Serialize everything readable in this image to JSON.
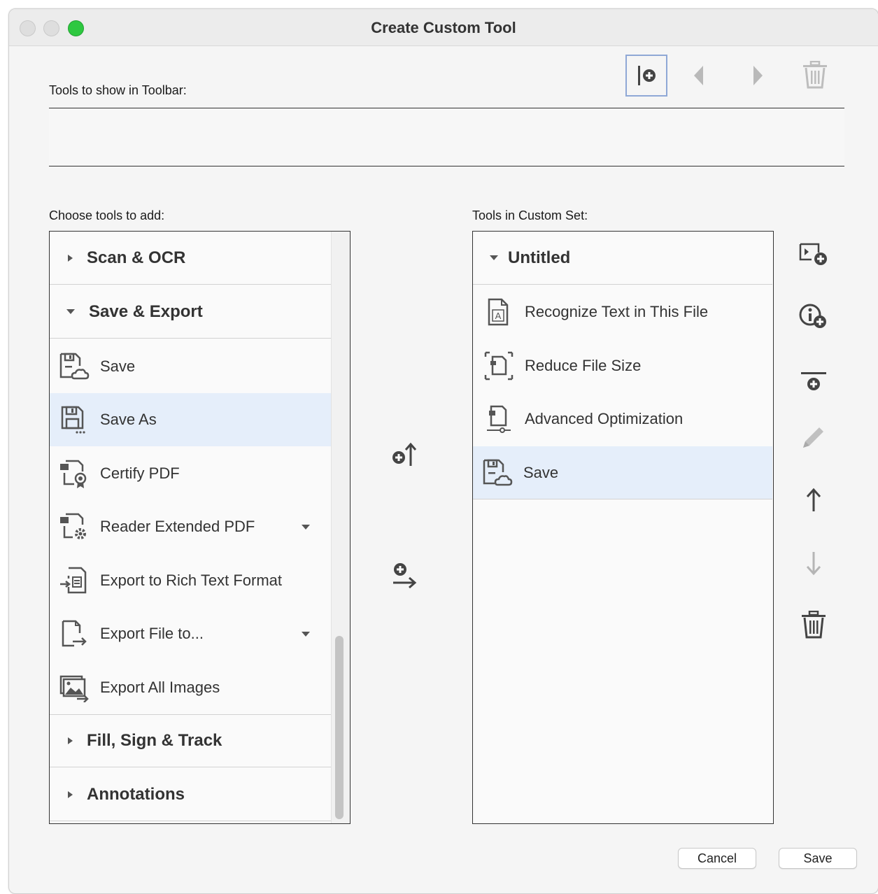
{
  "window": {
    "title": "Create Custom Tool"
  },
  "toolbar_section": {
    "label": "Tools to show in Toolbar:"
  },
  "left_panel": {
    "label": "Choose tools to add:",
    "groups": [
      {
        "label": "Scan & OCR",
        "expanded": false
      },
      {
        "label": "Save & Export",
        "expanded": true
      },
      {
        "label": "Fill, Sign & Track",
        "expanded": false
      },
      {
        "label": "Annotations",
        "expanded": false
      }
    ],
    "items": [
      {
        "label": "Save",
        "icon": "save-cloud-icon",
        "selected": false,
        "has_dropdown": false
      },
      {
        "label": "Save As",
        "icon": "save-as-icon",
        "selected": true,
        "has_dropdown": false
      },
      {
        "label": "Certify PDF",
        "icon": "certify-pdf-icon",
        "selected": false,
        "has_dropdown": false
      },
      {
        "label": "Reader Extended PDF",
        "icon": "reader-extended-pdf-icon",
        "selected": false,
        "has_dropdown": true
      },
      {
        "label": "Export to Rich Text Format",
        "icon": "export-rtf-icon",
        "selected": false,
        "has_dropdown": false
      },
      {
        "label": "Export File to...",
        "icon": "export-file-icon",
        "selected": false,
        "has_dropdown": true
      },
      {
        "label": "Export All Images",
        "icon": "export-images-icon",
        "selected": false,
        "has_dropdown": false
      }
    ]
  },
  "right_panel": {
    "label": "Tools in Custom Set:",
    "group": {
      "label": "Untitled",
      "expanded": true
    },
    "items": [
      {
        "label": "Recognize Text in This File",
        "icon": "recognize-text-icon",
        "selected": false
      },
      {
        "label": "Reduce File Size",
        "icon": "reduce-file-size-icon",
        "selected": false
      },
      {
        "label": "Advanced Optimization",
        "icon": "advanced-optimization-icon",
        "selected": false
      },
      {
        "label": "Save",
        "icon": "save-cloud-icon",
        "selected": true
      }
    ]
  },
  "buttons": {
    "cancel": "Cancel",
    "save": "Save"
  },
  "colors": {
    "selection": "#e5eefa",
    "traffic_green": "#2ec840",
    "focus_ring": "#8fa8d6"
  }
}
